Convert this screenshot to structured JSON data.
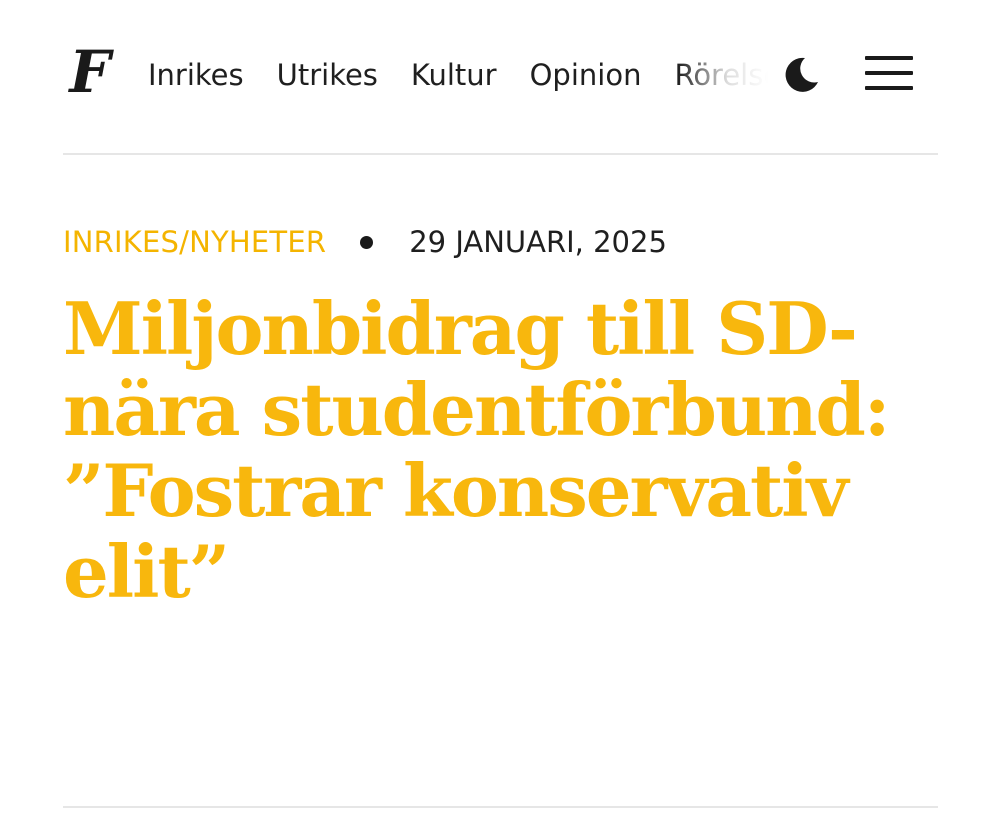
{
  "header": {
    "logo_letter": "F",
    "nav_items": [
      "Inrikes",
      "Utrikes",
      "Kultur",
      "Opinion",
      "Rörelsen"
    ],
    "theme_icon": "moon-icon",
    "menu_icon": "hamburger-menu-icon"
  },
  "article": {
    "category": "INRIKES/NYHETER",
    "date": "29 JANUARI, 2025",
    "headline": "Miljonbidrag till SD-nära studentförbund: ”Fostrar konservativ elit”"
  },
  "colors": {
    "accent": "#f8b70d",
    "text": "#1f1f1f",
    "divider": "#e6e6e6",
    "background": "#ffffff"
  }
}
